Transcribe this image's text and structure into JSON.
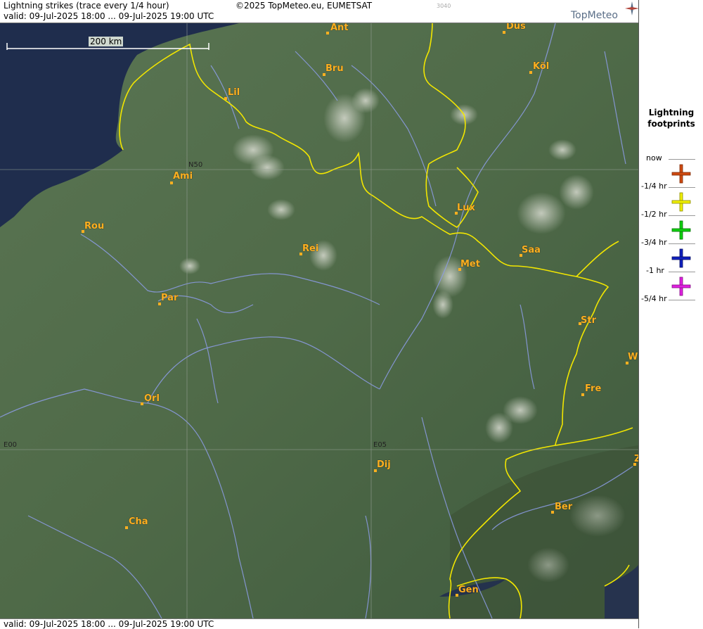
{
  "header": {
    "title": "Lightning strikes (trace every 1/4 hour)",
    "valid": "valid:  09-Jul-2025 18:00 ... 09-Jul-2025 19:00 UTC",
    "copyright": "©2025 TopMeteo.eu, EUMETSAT",
    "code": "3040",
    "brand": "TopMeteo"
  },
  "footer": {
    "valid": "valid:  09-Jul-2025 18:00 ... 09-Jul-2025 19:00 UTC"
  },
  "map": {
    "scale_label": "200 km",
    "grid_labels": {
      "n50": "N50",
      "e00": "E00",
      "e05": "E05"
    },
    "cities": {
      "ant": "Ant",
      "dus": "Düs",
      "bru": "Bru",
      "kol": "Köl",
      "lil": "Lil",
      "ami": "Ami",
      "rou": "Rou",
      "lux": "Lux",
      "rei": "Rei",
      "saa": "Saa",
      "met": "Met",
      "par": "Par",
      "str": "Str",
      "w": "W",
      "fre": "Fre",
      "orl": "Orl",
      "dij": "Dij",
      "ber": "Ber",
      "cha": "Cha",
      "gen": "Gen",
      "z": "Z"
    },
    "colors": {
      "land": "#4e6a4a",
      "sea": "#1f2d4d",
      "border": "#f2e600",
      "river": "#8d9de8",
      "city": "#ffb020"
    }
  },
  "legend": {
    "title_1": "Lightning",
    "title_2": "footprints",
    "rows": [
      {
        "label": "now",
        "color": ""
      },
      {
        "label": "-1/4 hr",
        "color": "#d04a10"
      },
      {
        "label": "-1/2 hr",
        "color": "#f0f000"
      },
      {
        "label": "-3/4 hr",
        "color": "#10d010"
      },
      {
        "label": "-1 hr",
        "color": "#1020c0"
      },
      {
        "label": "-5/4 hr",
        "color": "#e020e0"
      }
    ]
  }
}
